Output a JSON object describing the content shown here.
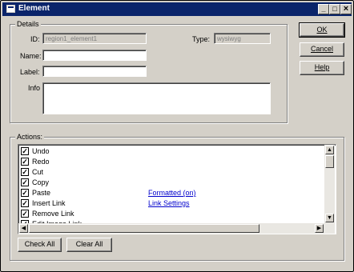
{
  "window": {
    "title": "Element",
    "min_glyph": "_",
    "max_glyph": "□",
    "close_glyph": "×"
  },
  "details": {
    "legend": "Details",
    "id_label": "ID:",
    "id_value": "region1_element1",
    "type_label": "Type:",
    "type_value": "wysiwyg",
    "name_label": "Name:",
    "name_value": "",
    "label_label": "Label:",
    "label_value": "",
    "info_label": "Info",
    "info_value": ""
  },
  "buttons": {
    "ok": "OK",
    "cancel": "Cancel",
    "help": "Help",
    "check_all": "Check All",
    "clear_all": "Clear All"
  },
  "actions": {
    "legend": "Actions:",
    "items": [
      {
        "label": "Undo",
        "checked": true,
        "link": ""
      },
      {
        "label": "Redo",
        "checked": true,
        "link": ""
      },
      {
        "label": "Cut",
        "checked": true,
        "link": ""
      },
      {
        "label": "Copy",
        "checked": true,
        "link": ""
      },
      {
        "label": "Paste",
        "checked": true,
        "link": "Formatted (on)"
      },
      {
        "label": "Insert Link",
        "checked": true,
        "link": "Link Settings"
      },
      {
        "label": "Remove Link",
        "checked": true,
        "link": ""
      },
      {
        "label": "Edit Image Link",
        "checked": true,
        "link": ""
      }
    ]
  },
  "scroll": {
    "up": "▲",
    "down": "▼",
    "left": "◀",
    "right": "▶"
  }
}
